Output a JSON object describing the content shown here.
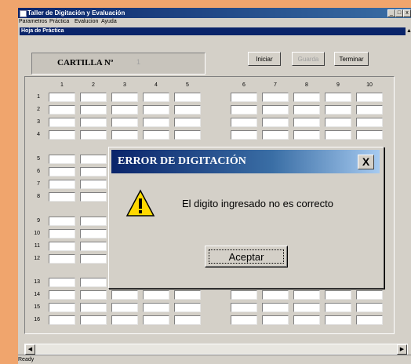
{
  "window": {
    "title": "Taller de Digitación y Evaluación",
    "minimize": "_",
    "maximize": "□",
    "close": "x"
  },
  "menubar": {
    "items": [
      "Parametros",
      "Práctica",
      "Evalucion",
      "Ayuda"
    ]
  },
  "subwindow": {
    "title": "Hoja de Práctica"
  },
  "header": {
    "cartilla_label": "CARTILLA Nº",
    "cartilla_number": "1",
    "buttons": {
      "iniciar": "Iniciar",
      "guardar": "Guarda",
      "terminar": "Terminar"
    }
  },
  "grid": {
    "columns": [
      "1",
      "2",
      "3",
      "4",
      "5",
      "6",
      "7",
      "8",
      "9",
      "10"
    ],
    "rows": [
      "1",
      "2",
      "3",
      "4",
      "5",
      "6",
      "7",
      "8",
      "9",
      "10",
      "11",
      "12",
      "13",
      "14",
      "15",
      "16"
    ]
  },
  "statusbar": {
    "text": "Ready"
  },
  "dialog": {
    "title": "ERROR DE DIGITACIÓN",
    "close": "X",
    "message": "El digito ingresado no es correcto",
    "ok_label": "Aceptar",
    "icon": "warning-icon"
  },
  "colors": {
    "desktop": "#f0a56d",
    "title_bar": "#0a246a",
    "window_face": "#d4d0c8"
  }
}
